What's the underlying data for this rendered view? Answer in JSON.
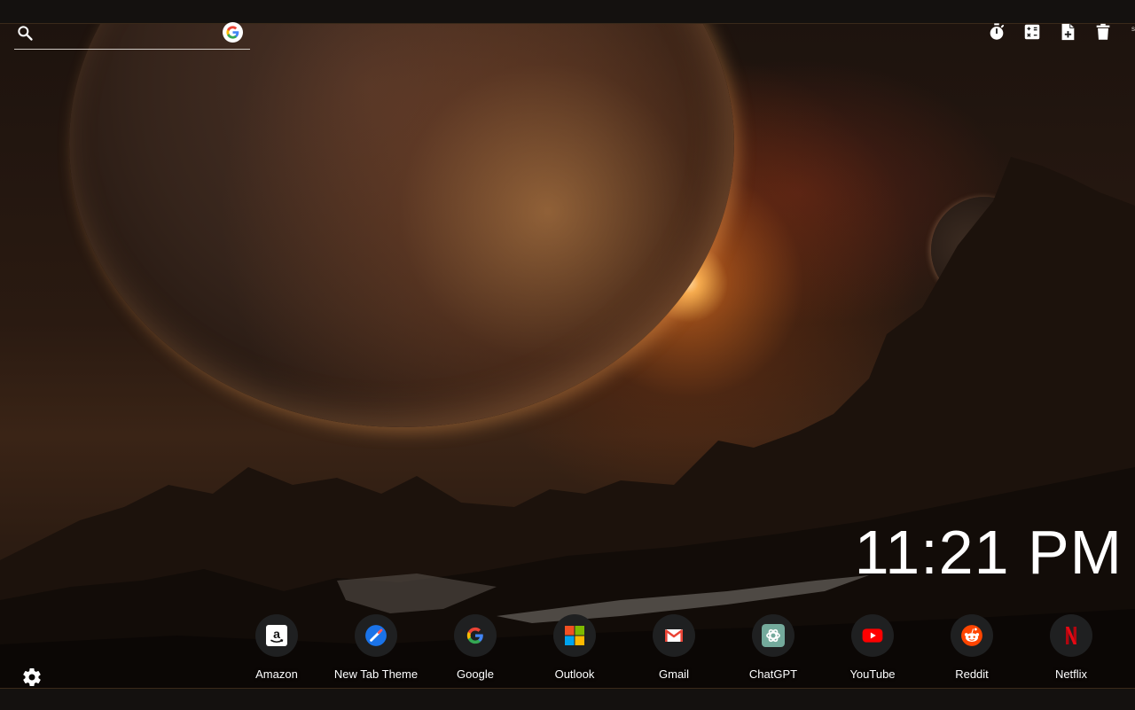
{
  "search": {
    "value": "",
    "placeholder": ""
  },
  "toolbar": {
    "icons": [
      "stopwatch-icon",
      "calculator-icon",
      "add-note-icon",
      "trash-icon"
    ],
    "edge_letter": "s"
  },
  "clock": {
    "time": "11:21 PM"
  },
  "shortcuts": [
    {
      "label": "Amazon",
      "icon": "amazon-icon"
    },
    {
      "label": "New Tab Theme",
      "icon": "new-tab-theme-icon"
    },
    {
      "label": "Google",
      "icon": "google-icon"
    },
    {
      "label": "Outlook",
      "icon": "outlook-icon"
    },
    {
      "label": "Gmail",
      "icon": "gmail-icon"
    },
    {
      "label": "ChatGPT",
      "icon": "chatgpt-icon"
    },
    {
      "label": "YouTube",
      "icon": "youtube-icon"
    },
    {
      "label": "Reddit",
      "icon": "reddit-icon"
    },
    {
      "label": "Netflix",
      "icon": "netflix-icon"
    }
  ],
  "colors": {
    "google_blue": "#4285F4",
    "google_red": "#EA4335",
    "google_yellow": "#FBBC05",
    "google_green": "#34A853",
    "youtube_red": "#FF0000",
    "reddit_orange": "#FF4500",
    "netflix_red": "#E50914",
    "chatgpt_green": "#74AA9C"
  }
}
